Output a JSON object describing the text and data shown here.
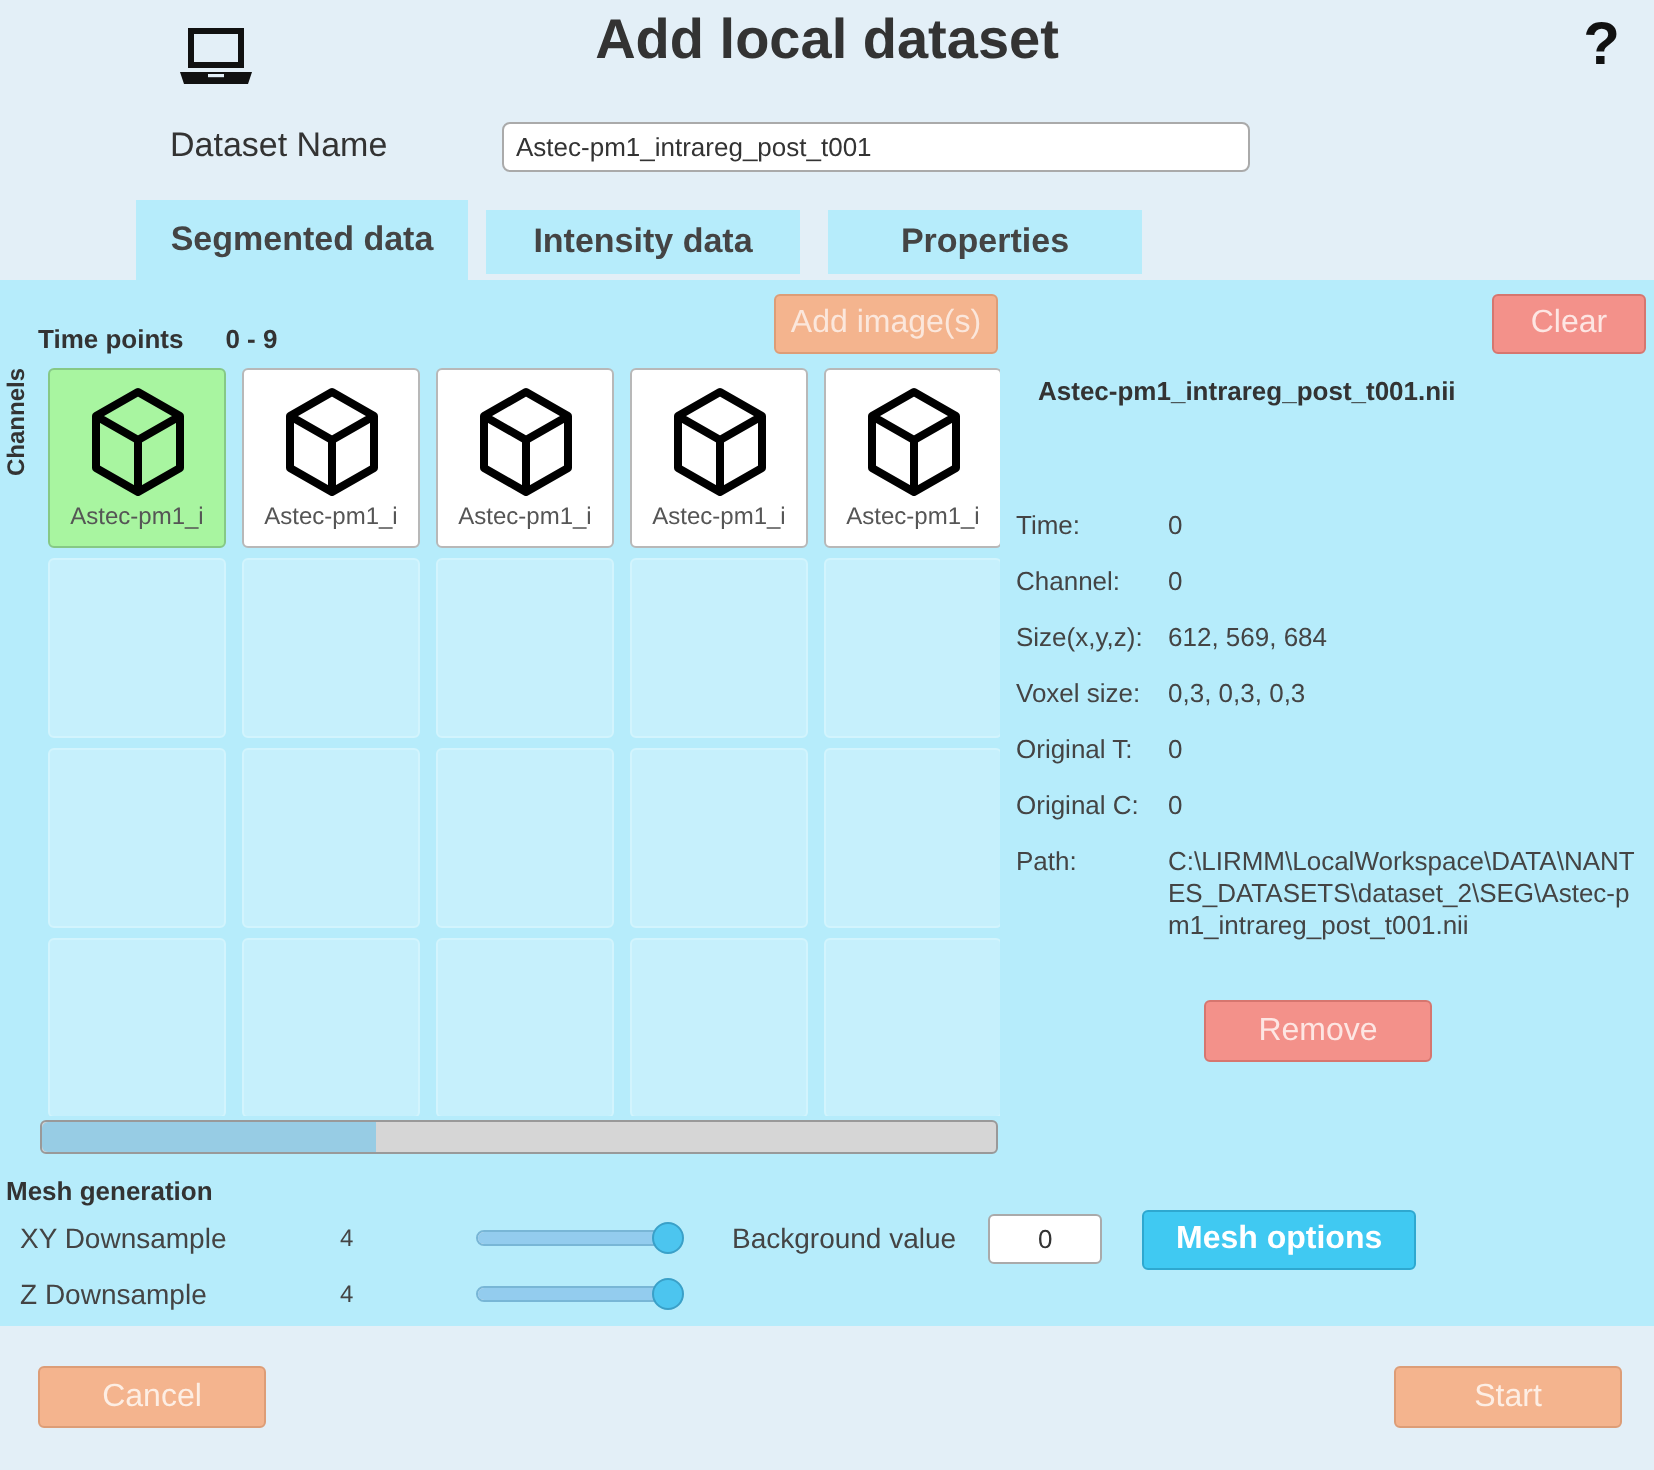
{
  "window": {
    "title": "Add local dataset"
  },
  "help": "?",
  "dataset_name": {
    "label": "Dataset Name",
    "value": "Astec-pm1_intrareg_post_t001"
  },
  "tabs": [
    {
      "label": "Segmented data",
      "selected": true
    },
    {
      "label": "Intensity data",
      "selected": false
    },
    {
      "label": "Properties",
      "selected": false
    }
  ],
  "panel": {
    "time_points_label": "Time points",
    "time_points_range": "0 - 9",
    "channels_label": "Channels",
    "add_button": "Add image(s)",
    "clear_button": "Clear",
    "thumbnails": [
      {
        "label": "Astec-pm1_i",
        "selected": true
      },
      {
        "label": "Astec-pm1_i",
        "selected": false
      },
      {
        "label": "Astec-pm1_i",
        "selected": false
      },
      {
        "label": "Astec-pm1_i",
        "selected": false
      },
      {
        "label": "Astec-pm1_i",
        "selected": false
      }
    ]
  },
  "details": {
    "title": "Astec-pm1_intrareg_post_t001.nii",
    "fields": [
      {
        "label": "Time:",
        "value": "0"
      },
      {
        "label": "Channel:",
        "value": "0"
      },
      {
        "label": "Size(x,y,z):",
        "value": "612, 569, 684"
      },
      {
        "label": "Voxel size:",
        "value": "0,3, 0,3, 0,3"
      },
      {
        "label": "Original T:",
        "value": "0"
      },
      {
        "label": "Original C:",
        "value": "0"
      },
      {
        "label": "Path:",
        "value": "C:\\LIRMM\\LocalWorkspace\\DATA\\NANTES_DATASETS\\dataset_2\\SEG\\Astec-pm1_intrareg_post_t001.nii"
      }
    ],
    "remove_button": "Remove"
  },
  "mesh": {
    "title": "Mesh generation",
    "sliders": [
      {
        "label": "XY Downsample",
        "reading": "4",
        "level": 1
      },
      {
        "label": "Z Downsample",
        "reading": "4",
        "level": 1
      }
    ],
    "background": {
      "label": "Background value",
      "value": "0"
    },
    "options_button": "Mesh options"
  },
  "footer": {
    "cancel_button": "Cancel",
    "start_button": "Start"
  }
}
